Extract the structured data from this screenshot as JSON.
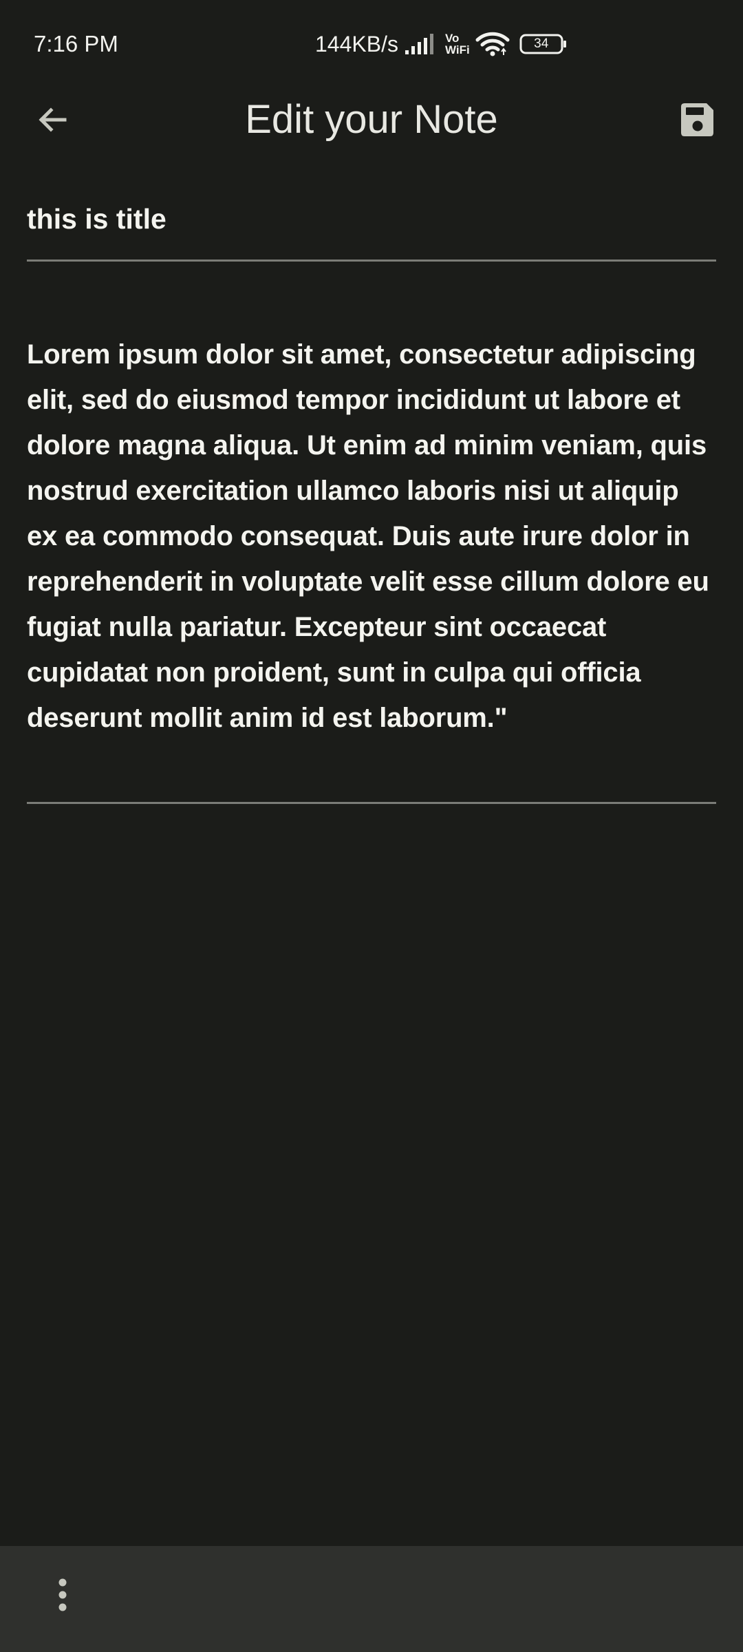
{
  "status_bar": {
    "time": "7:16 PM",
    "network_speed": "144KB/s",
    "vowifi_top": "Vo",
    "vowifi_bottom": "WiFi",
    "battery_level": "34"
  },
  "app_bar": {
    "title": "Edit your Note",
    "back_icon": "arrow-back-icon",
    "save_icon": "save-floppy-icon"
  },
  "note": {
    "title_value": "this is title",
    "body_value": "Lorem ipsum dolor sit amet, consectetur adipiscing elit, sed do eiusmod tempor incididunt ut labore et dolore magna aliqua. Ut enim ad minim veniam, quis nostrud exercitation ullamco laboris nisi ut aliquip ex ea commodo consequat. Duis aute irure dolor in reprehenderit in voluptate velit esse cillum dolore eu fugiat nulla pariatur. Excepteur sint occaecat cupidatat non proident, sunt in culpa qui officia deserunt mollit anim id est laborum.\""
  },
  "bottom_bar": {
    "more_icon": "more-vert-icon"
  },
  "colors": {
    "background": "#1b1c19",
    "bottom_bar": "#2f302d",
    "text": "#f4f4ef",
    "divider": "#7b7c77",
    "icon": "#c7c8bf"
  }
}
